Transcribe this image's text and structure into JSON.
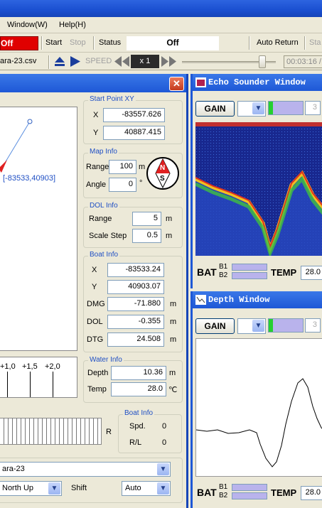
{
  "menu": {
    "window": "Window(W)",
    "help": "Help(H)"
  },
  "toolbar": {
    "off_label": "Off",
    "start": "Start",
    "stop": "Stop",
    "status_label": "Status",
    "status_value": "Off",
    "auto_return": "Auto Return",
    "start_cut": "Sta"
  },
  "toolbar2": {
    "file": "ara-23.csv",
    "speed": "SPEED",
    "speed_mult": "x 1",
    "time": "00:03:16 /"
  },
  "left_panel": {
    "coord_label": "[-83533,40903]",
    "start_point": {
      "title": "Start Point XY",
      "x_label": "X",
      "x": "-83557.626",
      "y_label": "Y",
      "y": "40887.415"
    },
    "map_info": {
      "title": "Map Info",
      "range_label": "Range",
      "range": "100",
      "range_unit": "m",
      "angle_label": "Angle",
      "angle": "0",
      "angle_unit": "°",
      "compass_n": "N",
      "compass_s": "S"
    },
    "dol_info": {
      "title": "DOL Info",
      "range_label": "Range",
      "range": "5",
      "range_unit": "m",
      "scale_label": "Scale Step",
      "scale": "0.5",
      "scale_unit": "m"
    },
    "boat_info": {
      "title": "Boat Info",
      "x_label": "X",
      "x": "-83533.24",
      "y_label": "Y",
      "y": "40903.07",
      "dmg_label": "DMG",
      "dmg": "-71.880",
      "dol_label": "DOL",
      "dol": "-0.355",
      "dtg_label": "DTG",
      "dtg": "24.508",
      "unit": "m"
    },
    "scale_ticks": [
      "+1,0",
      "+1,5",
      "+2,0"
    ],
    "water_info": {
      "title": "Water Info",
      "depth_label": "Depth",
      "depth": "10.36",
      "depth_unit": "m",
      "temp_label": "Temp",
      "temp": "28.0",
      "temp_unit": "℃"
    },
    "rudder_r": "R",
    "boat_info2": {
      "title": "Boat Info",
      "spd_label": "Spd.",
      "spd": "0",
      "rl_label": "R/L",
      "rl": "0"
    },
    "route_select": "ara-23",
    "orientation_select": "North Up",
    "shift_label": "Shift",
    "shift_select": "Auto"
  },
  "echo": {
    "title": "Echo Sounder Window",
    "gain": "GAIN",
    "gain_num": "3",
    "bat": "BAT",
    "b1": "B1",
    "b2": "B2",
    "temp": "TEMP",
    "temp_val": "28.0"
  },
  "depth": {
    "title": "Depth Window",
    "gain": "GAIN",
    "gain_num": "3",
    "bat": "BAT",
    "b1": "B1",
    "b2": "B2",
    "temp": "TEMP",
    "temp_val": "28.0"
  },
  "colors": {
    "accent": "#1f4fc4",
    "title_blue": "#2d64e0",
    "off_red": "#e00000",
    "echo_bg": "#1a2a9a"
  }
}
